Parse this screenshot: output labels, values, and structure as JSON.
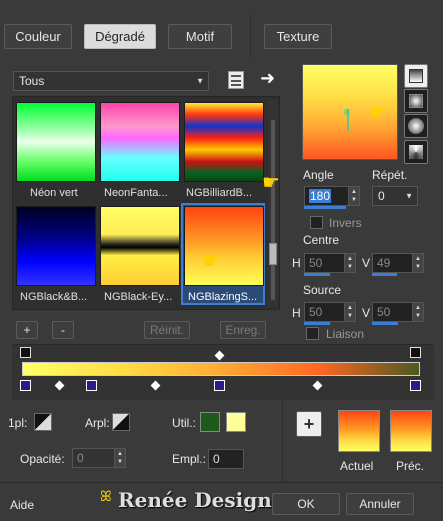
{
  "tabs": [
    {
      "label": "Couleur",
      "active": false
    },
    {
      "label": "Dégradé",
      "active": true
    },
    {
      "label": "Motif",
      "active": false
    },
    {
      "label": "Texture",
      "active": false
    }
  ],
  "category_select": {
    "value": "Tous"
  },
  "gradients": [
    {
      "name": "Néon vert",
      "selected": false
    },
    {
      "name": "NeonFanta...",
      "selected": false
    },
    {
      "name": "NGBilliardB...",
      "selected": false
    },
    {
      "name": "NGBlack&B...",
      "selected": false
    },
    {
      "name": "NGBlack-Ey...",
      "selected": false
    },
    {
      "name": "NGBlazingS...",
      "selected": true
    }
  ],
  "list_buttons": {
    "add": "+",
    "remove": "-",
    "reset": "Réinit.",
    "save": "Enreg."
  },
  "props": {
    "angle_label": "Angle",
    "angle_value": "180",
    "repeat_label": "Répét.",
    "repeat_value": "0",
    "invert_label": "Invers",
    "center_label": "Centre",
    "center_h": "50",
    "center_v": "49",
    "source_label": "Source",
    "source_h": "50",
    "source_v": "50",
    "link_label": "Liaison",
    "h_label": "H",
    "v_label": "V"
  },
  "bottom": {
    "pl_label": "1pl:",
    "arpl_label": "Arpl:",
    "util_label": "Util.:",
    "opacity_label": "Opacité:",
    "opacity_value": "0",
    "empl_label": "Empl.:",
    "empl_value": "0",
    "current_label": "Actuel",
    "previous_label": "Préc.",
    "add_symbol": "+"
  },
  "footer": {
    "help": "Aide",
    "ok": "OK",
    "cancel": "Annuler",
    "watermark": "Renée Design"
  },
  "colors": {
    "util_color_1": "#1f5a1a",
    "util_color_2": "#ffff99",
    "selection_blue": "#3a7fd5"
  }
}
